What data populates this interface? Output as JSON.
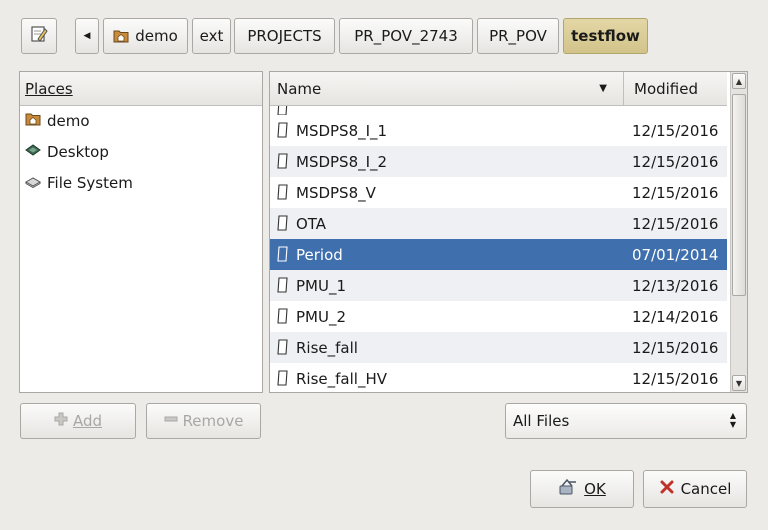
{
  "breadcrumb": {
    "items": [
      "demo",
      "ext",
      "PROJECTS",
      "PR_POV_2743",
      "PR_POV",
      "testflow"
    ]
  },
  "places": {
    "header": "Places",
    "items": [
      "demo",
      "Desktop",
      "File System"
    ]
  },
  "files": {
    "columns": {
      "name": "Name",
      "modified": "Modified"
    },
    "rows": [
      {
        "name": "MSDPS8_I_1",
        "modified": "12/15/2016"
      },
      {
        "name": "MSDPS8_I_2",
        "modified": "12/15/2016"
      },
      {
        "name": "MSDPS8_V",
        "modified": "12/15/2016"
      },
      {
        "name": "OTA",
        "modified": "12/15/2016"
      },
      {
        "name": "Period",
        "modified": "07/01/2014"
      },
      {
        "name": "PMU_1",
        "modified": "12/13/2016"
      },
      {
        "name": "PMU_2",
        "modified": "12/14/2016"
      },
      {
        "name": "Rise_fall",
        "modified": "12/15/2016"
      },
      {
        "name": "Rise_fall_HV",
        "modified": "12/15/2016"
      }
    ],
    "selected": "Period"
  },
  "buttons": {
    "add": "Add",
    "remove": "Remove",
    "ok": "OK",
    "cancel": "Cancel"
  },
  "filter": {
    "selected": "All Files"
  },
  "colors": {
    "selection": "#3f6fad",
    "active_crumb": "#d2c38a"
  }
}
